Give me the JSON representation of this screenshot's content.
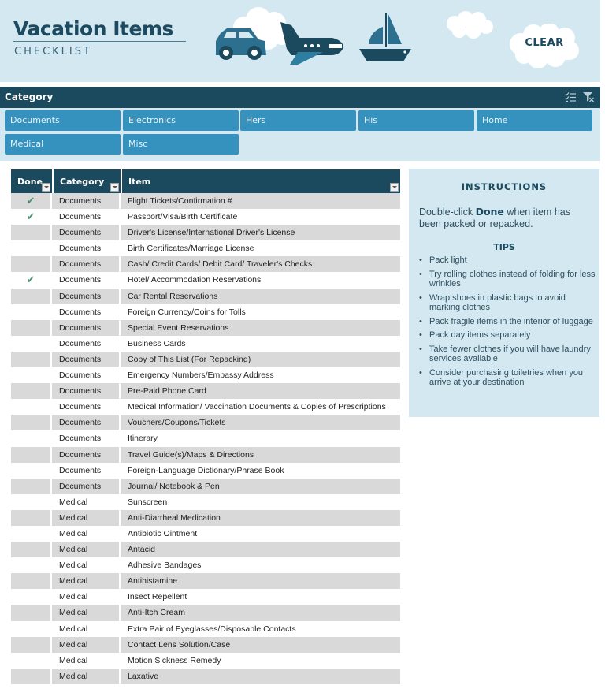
{
  "header": {
    "title": "Vacation Items",
    "subtitle": "CHECKLIST",
    "clear_label": "CLEAR",
    "icons": [
      "car-icon",
      "airplane-icon",
      "sailboat-icon",
      "cloud-icon"
    ]
  },
  "colors": {
    "dark_teal": "#1b4a5e",
    "slicer_button": "#3592be",
    "light_blue_bg": "#d3e8f1",
    "row_alt": "#d9d9d9",
    "check": "#4f8f6f"
  },
  "slicer": {
    "title": "Category",
    "icons": [
      "multi-select-icon",
      "clear-filter-icon"
    ],
    "buttons": [
      "Documents",
      "Electronics",
      "Hers",
      "His",
      "Home",
      "Medical",
      "Misc"
    ]
  },
  "table": {
    "headers": [
      "Done",
      "Category",
      "Item"
    ],
    "rows": [
      {
        "done": true,
        "category": "Documents",
        "item": "Flight Tickets/Confirmation #"
      },
      {
        "done": true,
        "category": "Documents",
        "item": "Passport/Visa/Birth Certificate"
      },
      {
        "done": false,
        "category": "Documents",
        "item": "Driver's License/International Driver's License"
      },
      {
        "done": false,
        "category": "Documents",
        "item": "Birth Certificates/Marriage License"
      },
      {
        "done": false,
        "category": "Documents",
        "item": "Cash/ Credit Cards/ Debit Card/ Traveler's Checks"
      },
      {
        "done": true,
        "category": "Documents",
        "item": "Hotel/ Accommodation Reservations"
      },
      {
        "done": false,
        "category": "Documents",
        "item": "Car Rental Reservations"
      },
      {
        "done": false,
        "category": "Documents",
        "item": "Foreign Currency/Coins for Tolls"
      },
      {
        "done": false,
        "category": "Documents",
        "item": "Special Event Reservations"
      },
      {
        "done": false,
        "category": "Documents",
        "item": "Business Cards"
      },
      {
        "done": false,
        "category": "Documents",
        "item": "Copy of This List (For Repacking)"
      },
      {
        "done": false,
        "category": "Documents",
        "item": "Emergency Numbers/Embassy Address"
      },
      {
        "done": false,
        "category": "Documents",
        "item": "Pre-Paid Phone Card"
      },
      {
        "done": false,
        "category": "Documents",
        "item": "Medical Information/ Vaccination Documents & Copies of Prescriptions"
      },
      {
        "done": false,
        "category": "Documents",
        "item": "Vouchers/Coupons/Tickets"
      },
      {
        "done": false,
        "category": "Documents",
        "item": "Itinerary"
      },
      {
        "done": false,
        "category": "Documents",
        "item": "Travel Guide(s)/Maps & Directions"
      },
      {
        "done": false,
        "category": "Documents",
        "item": "Foreign-Language Dictionary/Phrase Book"
      },
      {
        "done": false,
        "category": "Documents",
        "item": "Journal/ Notebook & Pen"
      },
      {
        "done": false,
        "category": "Medical",
        "item": "Sunscreen"
      },
      {
        "done": false,
        "category": "Medical",
        "item": "Anti-Diarrheal Medication"
      },
      {
        "done": false,
        "category": "Medical",
        "item": "Antibiotic Ointment"
      },
      {
        "done": false,
        "category": "Medical",
        "item": "Antacid"
      },
      {
        "done": false,
        "category": "Medical",
        "item": "Adhesive Bandages"
      },
      {
        "done": false,
        "category": "Medical",
        "item": "Antihistamine"
      },
      {
        "done": false,
        "category": "Medical",
        "item": "Insect Repellent"
      },
      {
        "done": false,
        "category": "Medical",
        "item": "Anti-Itch Cream"
      },
      {
        "done": false,
        "category": "Medical",
        "item": "Extra Pair of Eyeglasses/Disposable Contacts"
      },
      {
        "done": false,
        "category": "Medical",
        "item": "Contact Lens Solution/Case"
      },
      {
        "done": false,
        "category": "Medical",
        "item": "Motion Sickness Remedy"
      },
      {
        "done": false,
        "category": "Medical",
        "item": "Laxative"
      }
    ],
    "check_glyph": "✔"
  },
  "instructions": {
    "title": "INSTRUCTIONS",
    "text_before": "Double-click ",
    "text_bold": "Done",
    "text_after": " when item has been packed or repacked.",
    "tips_title": "TIPS",
    "tips": [
      "Pack light",
      "Try rolling clothes instead of folding for less wrinkles",
      "Wrap shoes in plastic bags to avoid marking clothes",
      "Pack fragile items in the interior of luggage",
      "Pack day items separately",
      "Take fewer clothes if you will have laundry services available",
      "Consider purchasing toiletries when you arrive at your destination"
    ]
  }
}
